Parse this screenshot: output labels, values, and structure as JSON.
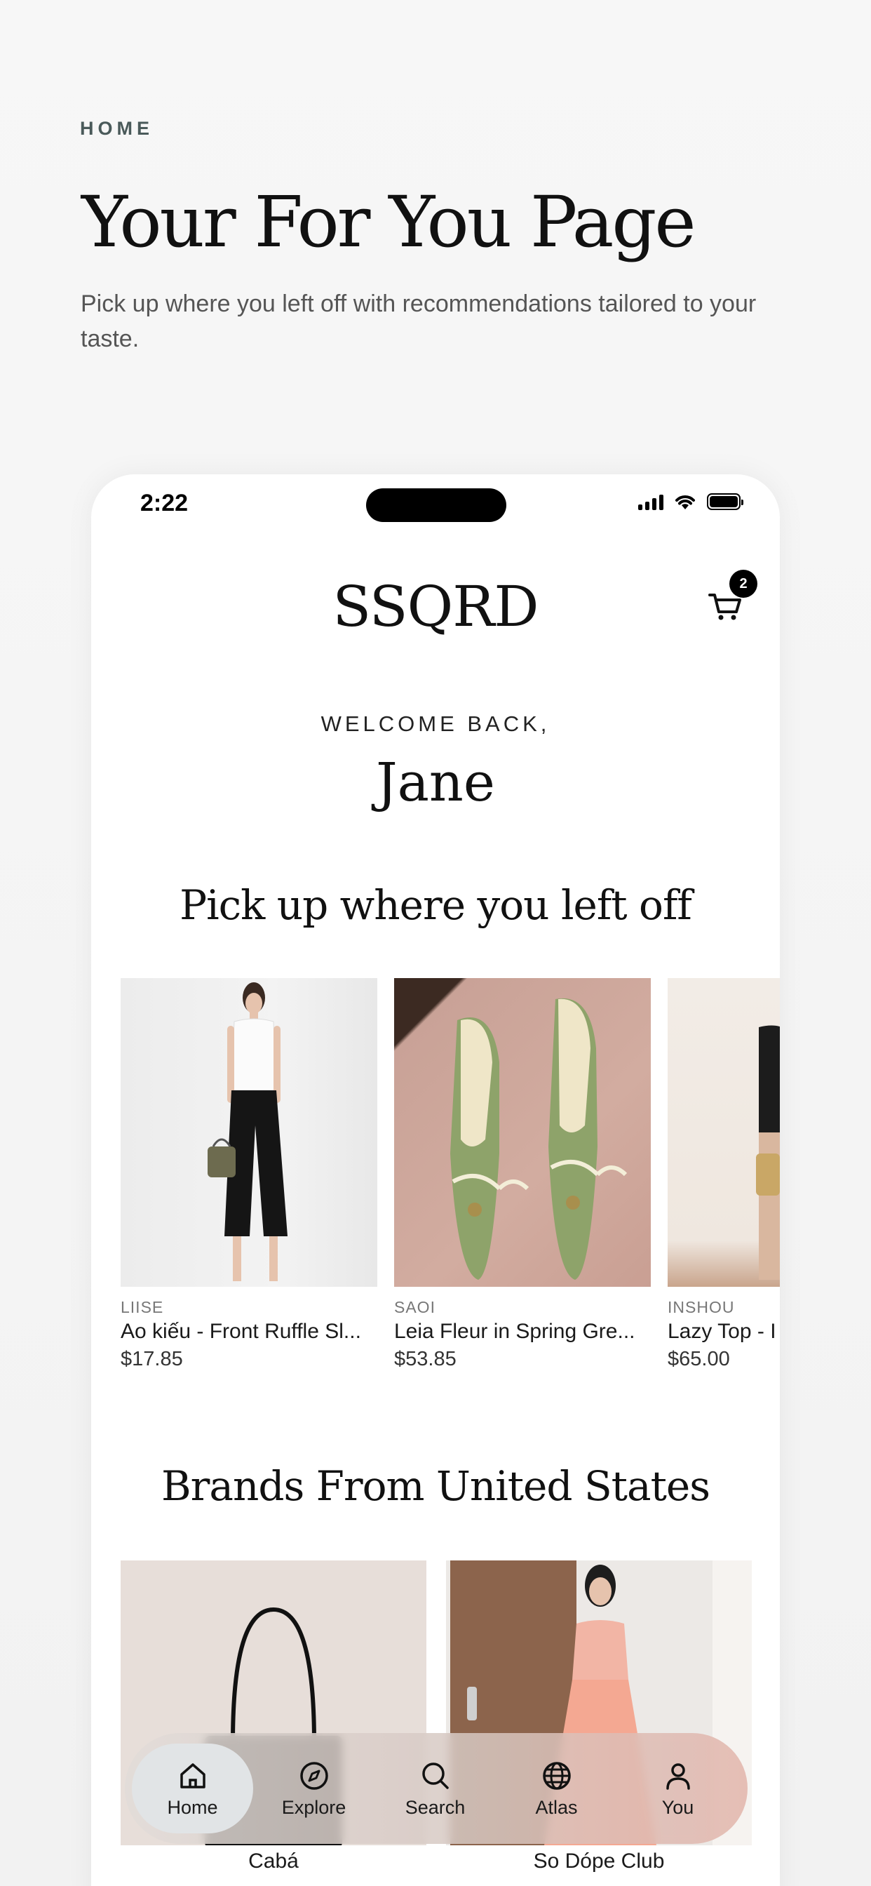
{
  "header": {
    "eyebrow": "HOME",
    "title": "Your For You Page",
    "subtitle": "Pick up where you left off with recommendations tailored to your taste."
  },
  "status_bar": {
    "time": "2:22"
  },
  "app": {
    "logo": "SSQRD",
    "cart_count": "2",
    "welcome": "WELCOME BACK,",
    "user_name": "Jane"
  },
  "sections": {
    "recent_title": "Pick up where you left off",
    "brands_title": "Brands From United States"
  },
  "products": [
    {
      "brand": "LIISE",
      "name": "Ao kiếu - Front Ruffle Sl...",
      "price": "$17.85"
    },
    {
      "brand": "SAOI",
      "name": "Leia Fleur in Spring Gre...",
      "price": "$53.85"
    },
    {
      "brand": "INSHOU",
      "name": "Lazy Top - I",
      "price": "$65.00"
    }
  ],
  "brands": [
    {
      "name": "Cabá"
    },
    {
      "name": "So Dópe Club"
    }
  ],
  "nav": {
    "items": [
      {
        "label": "Home",
        "icon": "home-icon",
        "active": true
      },
      {
        "label": "Explore",
        "icon": "compass-icon",
        "active": false
      },
      {
        "label": "Search",
        "icon": "search-icon",
        "active": false
      },
      {
        "label": "Atlas",
        "icon": "globe-icon",
        "active": false
      },
      {
        "label": "You",
        "icon": "user-icon",
        "active": false
      }
    ]
  },
  "colors": {
    "background": "#f5f5f5",
    "nav_active": "#e1e4e6",
    "text_primary": "#111111"
  }
}
